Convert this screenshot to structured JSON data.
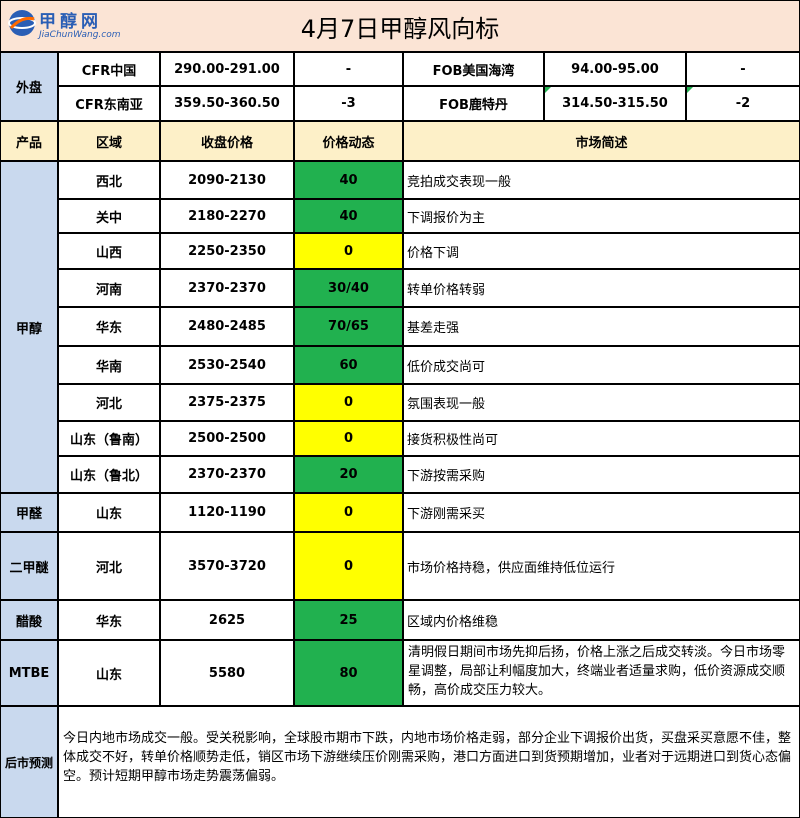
{
  "logo": {
    "cn": "甲醇网",
    "en": "JiaChunWang.com"
  },
  "title": "4月7日甲醇风向标",
  "external": {
    "label": "外盘",
    "rows": [
      {
        "m1": "CFR中国",
        "p1": "290.00-291.00",
        "c1": "-",
        "m2": "FOB美国海湾",
        "p2": "94.00-95.00",
        "c2": "-"
      },
      {
        "m1": "CFR东南亚",
        "p1": "359.50-360.50",
        "c1": "-3",
        "m2": "FOB鹿特丹",
        "p2": "314.50-315.50",
        "c2": "-2"
      }
    ]
  },
  "headers": {
    "product": "产品",
    "region": "区域",
    "price": "收盘价格",
    "change": "价格动态",
    "desc": "市场简述"
  },
  "groups": [
    {
      "product": "甲醇",
      "rows": [
        {
          "region": "西北",
          "price": "2090-2130",
          "change": "40",
          "color": "#21b14f",
          "desc": "竞拍成交表现一般"
        },
        {
          "region": "关中",
          "price": "2180-2270",
          "change": "40",
          "color": "#21b14f",
          "desc": "下调报价为主"
        },
        {
          "region": "山西",
          "price": "2250-2350",
          "change": "0",
          "color": "#ffff00",
          "desc": "价格下调"
        },
        {
          "region": "河南",
          "price": "2370-2370",
          "change": "30/40",
          "color": "#21b14f",
          "desc": "转单价格转弱"
        },
        {
          "region": "华东",
          "price": "2480-2485",
          "change": "70/65",
          "color": "#21b14f",
          "desc": "基差走强"
        },
        {
          "region": "华南",
          "price": "2530-2540",
          "change": "60",
          "color": "#21b14f",
          "desc": "低价成交尚可"
        },
        {
          "region": "河北",
          "price": "2375-2375",
          "change": "0",
          "color": "#ffff00",
          "desc": "氛围表现一般"
        },
        {
          "region": "山东（鲁南）",
          "price": "2500-2500",
          "change": "0",
          "color": "#ffff00",
          "desc": "接货积极性尚可"
        },
        {
          "region": "山东（鲁北）",
          "price": "2370-2370",
          "change": "20",
          "color": "#21b14f",
          "desc": "下游按需采购"
        }
      ]
    },
    {
      "product": "甲醛",
      "rows": [
        {
          "region": "山东",
          "price": "1120-1190",
          "change": "0",
          "color": "#ffff00",
          "desc": "下游刚需采买"
        }
      ]
    },
    {
      "product": "二甲醚",
      "rows": [
        {
          "region": "河北",
          "price": "3570-3720",
          "change": "0",
          "color": "#ffff00",
          "desc": "市场价格持稳，供应面维持低位运行"
        }
      ]
    },
    {
      "product": "醋酸",
      "rows": [
        {
          "region": "华东",
          "price": "2625",
          "change": "25",
          "color": "#21b14f",
          "desc": "区域内价格维稳"
        }
      ]
    },
    {
      "product": "MTBE",
      "rows": [
        {
          "region": "山东",
          "price": "5580",
          "change": "80",
          "color": "#21b14f",
          "desc": "清明假日期间市场先抑后扬，价格上涨之后成交转淡。今日市场零星调整，局部让利幅度加大，终端业者适量求购，低价资源成交顺畅，高价成交压力较大。"
        }
      ]
    }
  ],
  "forecast": {
    "label": "后市预测",
    "text": "今日内地市场成交一般。受关税影响，全球股市期市下跌，内地市场价格走弱，部分企业下调报价出货，买盘采买意愿不佳，整体成交不好，转单价格顺势走低，销区市场下游继续压价刚需采购，港口方面进口到货预期增加，业者对于远期进口到货心态偏空。预计短期甲醇市场走势震荡偏弱。"
  }
}
